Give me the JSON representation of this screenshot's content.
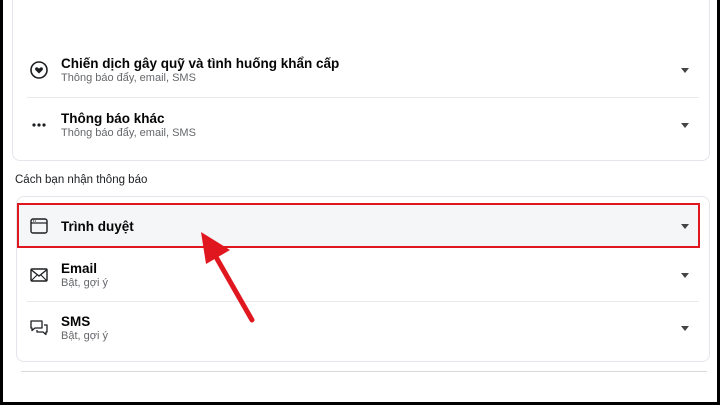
{
  "top_section": {
    "items": [
      {
        "title": "Chiến dịch gây quỹ và tình huống khẩn cấp",
        "subtitle": "Thông báo đẩy, email, SMS",
        "icon": "fundraiser-heart-icon"
      },
      {
        "title": "Thông báo khác",
        "subtitle": "Thông báo đẩy, email, SMS",
        "icon": "more-dots-icon"
      }
    ]
  },
  "delivery_section": {
    "label": "Cách bạn nhận thông báo",
    "items": [
      {
        "title": "Trình duyệt",
        "subtitle": "",
        "icon": "browser-window-icon",
        "highlighted": true
      },
      {
        "title": "Email",
        "subtitle": "Bật, gợi ý",
        "icon": "envelope-icon"
      },
      {
        "title": "SMS",
        "subtitle": "Bật, gợi ý",
        "icon": "chat-bubbles-icon"
      }
    ]
  },
  "annotation": {
    "highlight_color": "#e0171f",
    "arrow_color": "#e0171f"
  }
}
